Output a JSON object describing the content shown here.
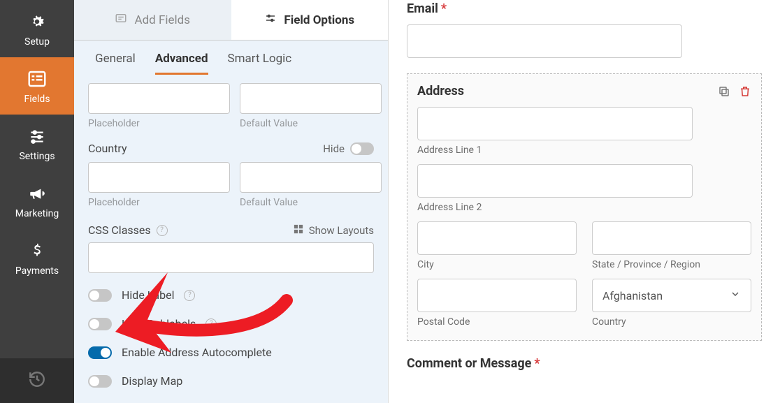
{
  "sidebar": {
    "setup": "Setup",
    "fields": "Fields",
    "settings": "Settings",
    "marketing": "Marketing",
    "payments": "Payments"
  },
  "panel": {
    "tabs": {
      "add_fields": "Add Fields",
      "field_options": "Field Options"
    },
    "subtabs": {
      "general": "General",
      "advanced": "Advanced",
      "smart_logic": "Smart Logic"
    },
    "placeholder_caption": "Placeholder",
    "default_value_caption": "Default Value",
    "country_label": "Country",
    "hide_label": "Hide",
    "css_classes": "CSS Classes",
    "show_layouts": "Show Layouts",
    "toggles": {
      "hide_label": "Hide Label",
      "hide_sublabels": "Hide Sublabels",
      "enable_address_ac": "Enable Address Autocomplete",
      "display_map": "Display Map"
    }
  },
  "preview": {
    "email_label": "Email",
    "address_label": "Address",
    "addr_line1": "Address Line 1",
    "addr_line2": "Address Line 2",
    "city": "City",
    "state": "State / Province / Region",
    "postal": "Postal Code",
    "country_label": "Country",
    "country_value": "Afghanistan",
    "comment_label": "Comment or Message"
  }
}
